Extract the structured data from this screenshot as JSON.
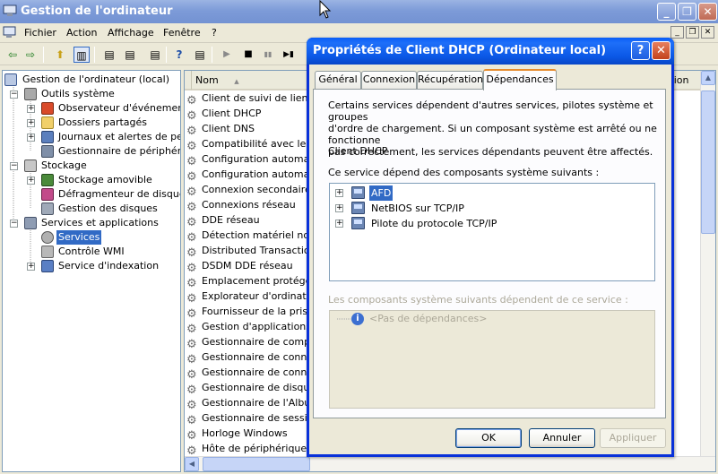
{
  "app": {
    "title": "Gestion de l'ordinateur",
    "buttons": [
      "_",
      "❐",
      "✕"
    ]
  },
  "menubar": {
    "items": [
      "Fichier",
      "Action",
      "Affichage",
      "Fenêtre",
      "?"
    ],
    "mdi_buttons": [
      "_",
      "❐",
      "✕"
    ]
  },
  "toolbar": {
    "back": "⇦",
    "forward": "⇨",
    "up": "⬆",
    "show_tree": "▥",
    "props": "▤",
    "help": "?",
    "play": "▶",
    "stop": "■",
    "pause": "▮▮",
    "restart": "▶▮"
  },
  "tree": {
    "items": [
      {
        "label": "Gestion de l'ordinateur (local)",
        "expander": "",
        "icon": "computer-icon"
      },
      {
        "label": "Outils système",
        "expander": "−",
        "icon": "tools-icon"
      },
      {
        "label": "Observateur d'événements",
        "expander": "+",
        "icon": "event-viewer-icon"
      },
      {
        "label": "Dossiers partagés",
        "expander": "+",
        "icon": "shared-folders-icon"
      },
      {
        "label": "Journaux et alertes de perfo",
        "expander": "+",
        "icon": "perf-logs-icon"
      },
      {
        "label": "Gestionnaire de périphérique",
        "expander": "",
        "icon": "device-manager-icon"
      },
      {
        "label": "Stockage",
        "expander": "−",
        "icon": "storage-icon"
      },
      {
        "label": "Stockage amovible",
        "expander": "+",
        "icon": "removable-storage-icon"
      },
      {
        "label": "Défragmenteur de disque",
        "expander": "",
        "icon": "defrag-icon"
      },
      {
        "label": "Gestion des disques",
        "expander": "",
        "icon": "disk-management-icon"
      },
      {
        "label": "Services et applications",
        "expander": "−",
        "icon": "services-apps-icon"
      },
      {
        "label": "Services",
        "expander": "",
        "icon": "services-icon"
      },
      {
        "label": "Contrôle WMI",
        "expander": "",
        "icon": "wmi-icon"
      },
      {
        "label": "Service d'indexation",
        "expander": "+",
        "icon": "indexing-icon"
      }
    ]
  },
  "list": {
    "columns": {
      "name": "Nom",
      "sort_arrow": "▲",
      "right_partial": "sion en"
    },
    "rows": [
      "Client de suivi de lien dis",
      "Client DHCP",
      "Client DNS",
      "Compatibilité avec le Cha",
      "Configuration automatiq",
      "Configuration automatiq",
      "Connexion secondaire",
      "Connexions réseau",
      "DDE réseau",
      "Détection matériel noyau",
      "Distributed Transaction C",
      "DSDM DDE réseau",
      "Emplacement protégé",
      "Explorateur d'ordinateurs",
      "Fournisseur de la prise en",
      "Gestion d'applications",
      "Gestionnaire de comptes",
      "Gestionnaire de connexio",
      "Gestionnaire de connexio",
      "Gestionnaire de disque lo",
      "Gestionnaire de l'Album",
      "Gestionnaire de session",
      "Horloge Windows",
      "Hôte de périphérique un"
    ]
  },
  "dialog": {
    "title": "Propriétés de Client DHCP (Ordinateur local)",
    "help_btn": "?",
    "close_btn": "✕",
    "tabs": [
      "Général",
      "Connexion",
      "Récupération",
      "Dépendances"
    ],
    "description": [
      "Certains services dépendent d'autres services, pilotes système et groupes",
      "d'ordre de chargement. Si un composant système est arrêté ou ne fonctionne",
      "pas correctement, les services dépendants peuvent être affectés."
    ],
    "service_name": "Client DHCP",
    "depends_on_label": "Ce service dépend des composants système suivants :",
    "depends_on": [
      {
        "label": "AFD",
        "expander": "+"
      },
      {
        "label": "NetBIOS sur TCP/IP",
        "expander": "+"
      },
      {
        "label": "Pilote du protocole TCP/IP",
        "expander": "+"
      }
    ],
    "dependents_label": "Les composants système suivants dépendent de ce service :",
    "dependents_empty": "<Pas de dépendances>",
    "buttons": {
      "ok": "OK",
      "cancel": "Annuler",
      "apply": "Appliquer"
    }
  },
  "colors": {
    "selection": "#316ac5",
    "dialog_frame": "#0831d9",
    "active_tab": "#e68b2c"
  }
}
